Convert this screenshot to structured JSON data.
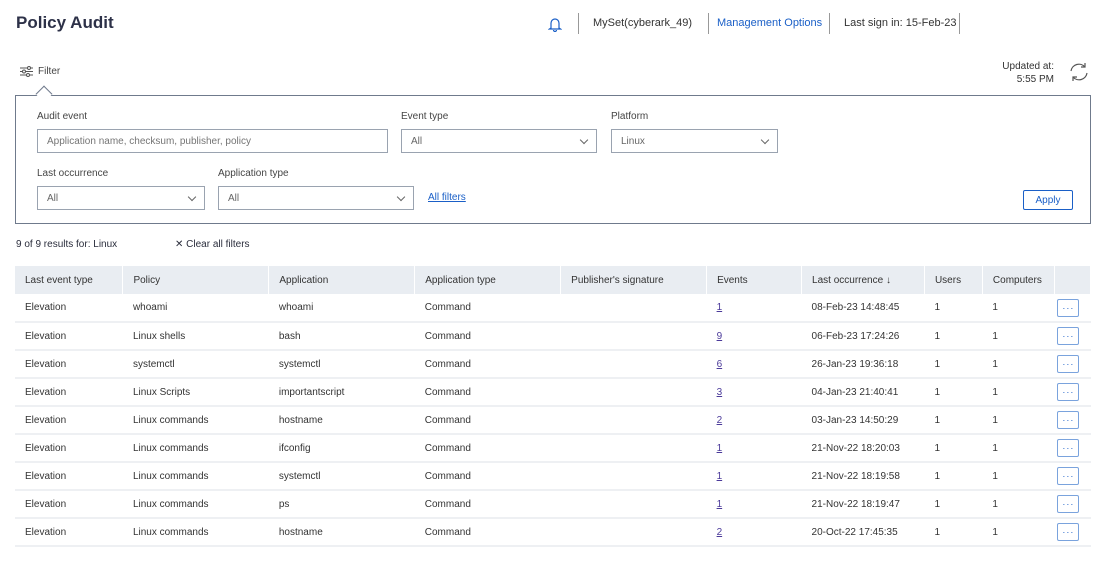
{
  "header": {
    "title": "Policy Audit",
    "set": "MySet(cyberark_49)",
    "management": "Management Options",
    "last_sign_in": "Last sign in: 15-Feb-23"
  },
  "toolbar": {
    "filter": "Filter",
    "updated_label": "Updated at:",
    "updated_time": "5:55 PM"
  },
  "filters": {
    "audit_event": {
      "label": "Audit event",
      "placeholder": "Application name, checksum, publisher, policy"
    },
    "event_type": {
      "label": "Event type",
      "value": "All"
    },
    "platform": {
      "label": "Platform",
      "value": "Linux"
    },
    "last_occurrence": {
      "label": "Last occurrence",
      "value": "All"
    },
    "application_type": {
      "label": "Application type",
      "value": "All"
    },
    "all_filters": "All filters",
    "apply": "Apply"
  },
  "results": {
    "summary": "9 of 9 results for: Linux",
    "clear": "Clear all filters"
  },
  "table": {
    "columns": [
      "Last event type",
      "Policy",
      "Application",
      "Application type",
      "Publisher's signature",
      "Events",
      "Last occurrence ↓",
      "Users",
      "Computers"
    ],
    "rows": [
      [
        "Elevation",
        "whoami",
        "whoami",
        "Command",
        "",
        "1",
        "08-Feb-23 14:48:45",
        "1",
        "1"
      ],
      [
        "Elevation",
        "Linux shells",
        "bash",
        "Command",
        "",
        "9",
        "06-Feb-23 17:24:26",
        "1",
        "1"
      ],
      [
        "Elevation",
        "systemctl",
        "systemctl",
        "Command",
        "",
        "6",
        "26-Jan-23 19:36:18",
        "1",
        "1"
      ],
      [
        "Elevation",
        "Linux Scripts",
        "importantscript",
        "Command",
        "",
        "3",
        "04-Jan-23 21:40:41",
        "1",
        "1"
      ],
      [
        "Elevation",
        "Linux commands",
        "hostname",
        "Command",
        "",
        "2",
        "03-Jan-23 14:50:29",
        "1",
        "1"
      ],
      [
        "Elevation",
        "Linux commands",
        "ifconfig",
        "Command",
        "",
        "1",
        "21-Nov-22 18:20:03",
        "1",
        "1"
      ],
      [
        "Elevation",
        "Linux commands",
        "systemctl",
        "Command",
        "",
        "1",
        "21-Nov-22 18:19:58",
        "1",
        "1"
      ],
      [
        "Elevation",
        "Linux commands",
        "ps",
        "Command",
        "",
        "1",
        "21-Nov-22 18:19:47",
        "1",
        "1"
      ],
      [
        "Elevation",
        "Linux commands",
        "hostname",
        "Command",
        "",
        "2",
        "20-Oct-22 17:45:35",
        "1",
        "1"
      ]
    ],
    "more_label": "···"
  }
}
